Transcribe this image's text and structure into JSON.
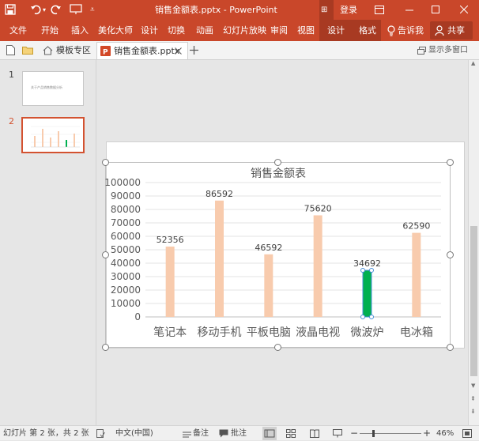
{
  "titlebar": {
    "title": "销售金额表.pptx  -  PowerPoint",
    "login": "登录",
    "quick_access": [
      "save-icon",
      "undo-icon",
      "redo-icon",
      "customize-icon"
    ]
  },
  "ribbon": {
    "tabs": [
      "文件",
      "开始",
      "插入",
      "美化大师",
      "设计",
      "切换",
      "动画",
      "幻灯片放映",
      "审阅",
      "视图"
    ],
    "context_tabs": [
      "设计",
      "格式"
    ],
    "tell_me": "告诉我",
    "share": "共享"
  },
  "tabbar": {
    "tabs": [
      "模板专区",
      "销售金额表.pptx"
    ],
    "multi_window": "显示多窗口"
  },
  "thumbnails": [
    {
      "num": "1",
      "text": "关于产品销售数据分析"
    },
    {
      "num": "2",
      "text": ""
    }
  ],
  "status": {
    "slide_info": "幻灯片 第 2 张，共 2 张",
    "language": "中文(中国)",
    "notes": "备注",
    "comments": "批注",
    "zoom": "46%"
  },
  "colors": {
    "accent": "#c9472a",
    "bar": "#f8cbad",
    "bar_selected": "#00b050"
  },
  "chart_data": {
    "type": "bar",
    "title": "销售金额表",
    "categories": [
      "笔记本",
      "移动手机",
      "平板电脑",
      "液晶电视",
      "微波炉",
      "电冰箱"
    ],
    "values": [
      52356,
      86592,
      46592,
      75620,
      34692,
      62590
    ],
    "value_labels": [
      "52356",
      "86592",
      "46592",
      "75620",
      "34692",
      "62590"
    ],
    "ylim": [
      0,
      100000
    ],
    "yticks": [
      "0",
      "10000",
      "20000",
      "30000",
      "40000",
      "50000",
      "60000",
      "70000",
      "80000",
      "90000",
      "100000"
    ],
    "grid": true,
    "selected_index": 4
  }
}
